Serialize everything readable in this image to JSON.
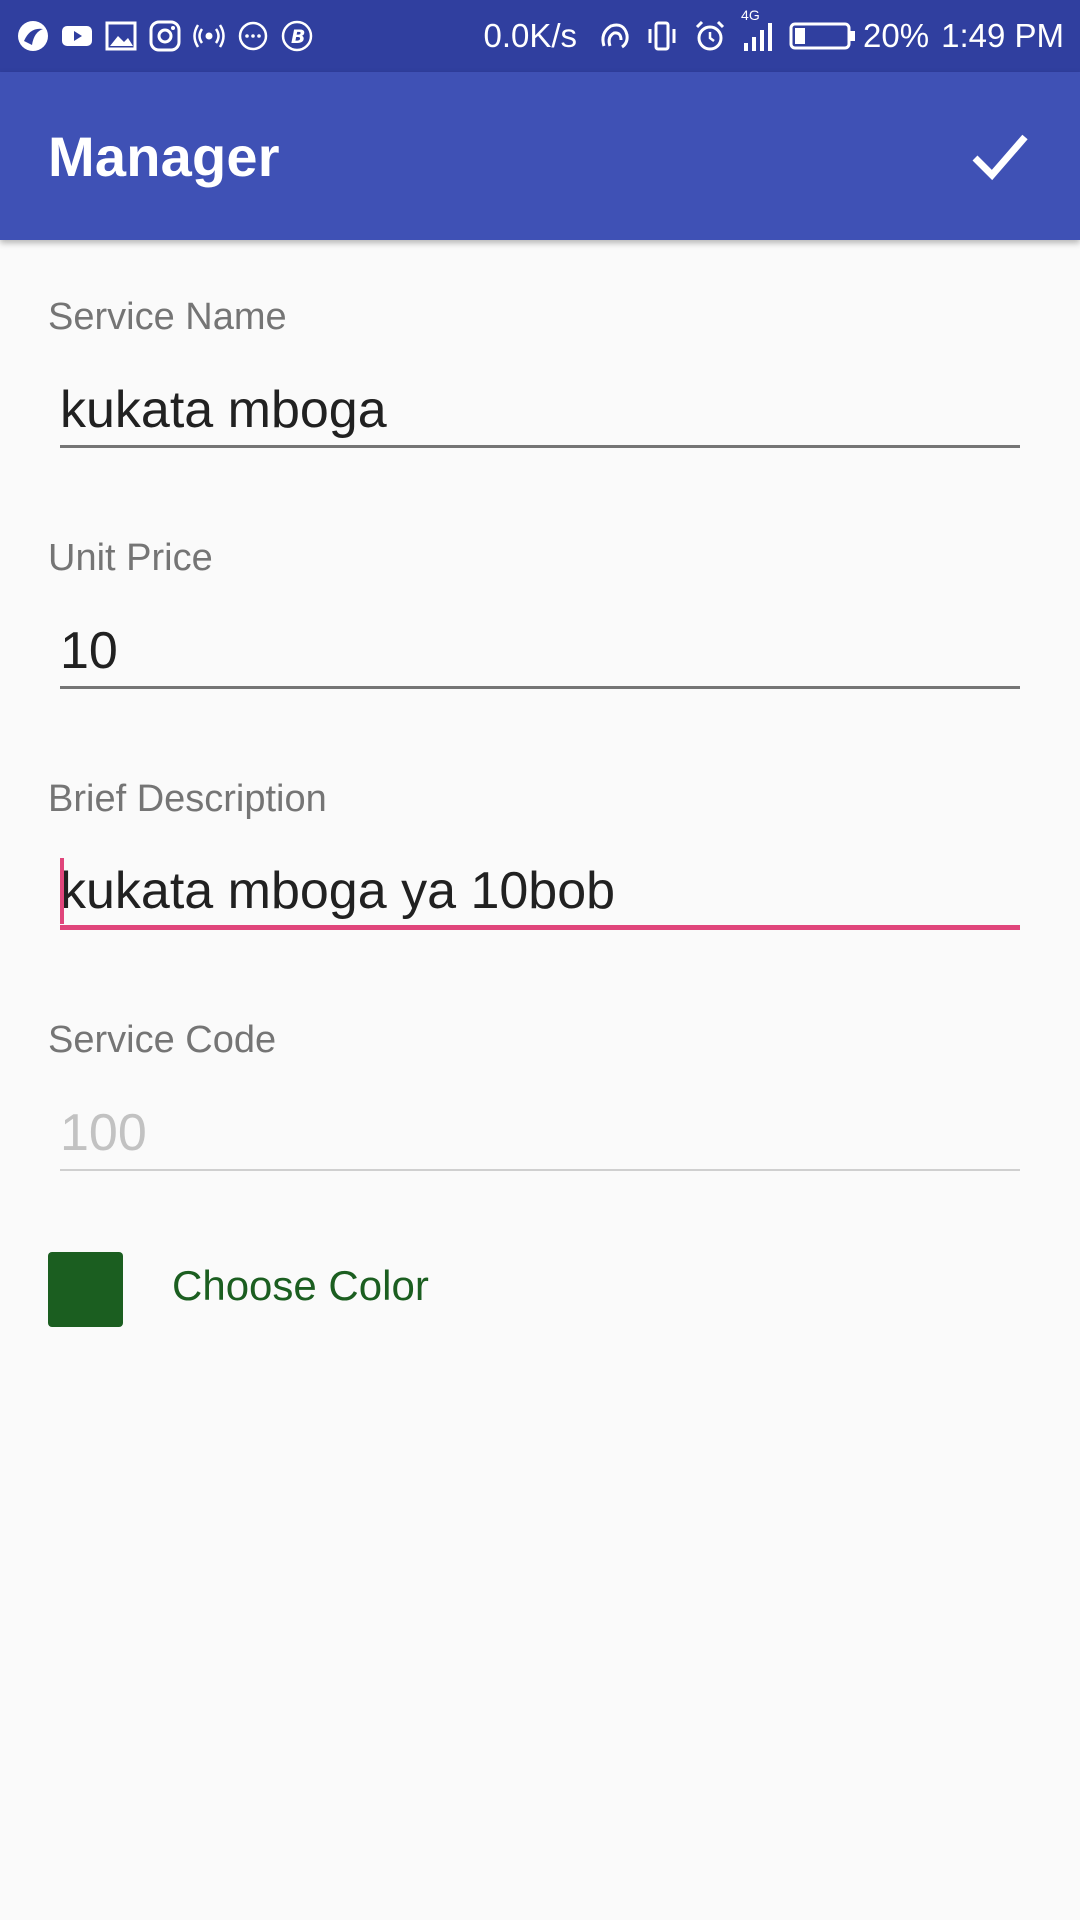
{
  "status_bar": {
    "net_speed": "0.0K/s",
    "network_type": "4G",
    "battery_percent": "20%",
    "time": "1:49 PM",
    "background_color": "#303f9f",
    "icons_left": [
      "falcon-icon",
      "youtube-icon",
      "image-icon",
      "instagram-icon",
      "hotspot-icon",
      "messenger-icon",
      "b-icon"
    ],
    "icons_right": [
      "nfc-icon",
      "vibrate-icon",
      "alarm-icon",
      "signal-icon",
      "battery-icon"
    ]
  },
  "app_bar": {
    "title": "Manager",
    "action_icon": "check-icon",
    "background_color": "#3f51b5"
  },
  "form": {
    "service_name": {
      "label": "Service Name",
      "value": "kukata mboga"
    },
    "unit_price": {
      "label": "Unit Price",
      "value": "10"
    },
    "brief_description": {
      "label": "Brief Description",
      "value": "kukata mboga ya 10bob",
      "focused": true
    },
    "service_code": {
      "label": "Service Code",
      "placeholder": "100",
      "enabled": false
    },
    "color_picker": {
      "label": "Choose Color",
      "selected_color": "#1b5e20"
    }
  },
  "accent_color": "#e0457b"
}
